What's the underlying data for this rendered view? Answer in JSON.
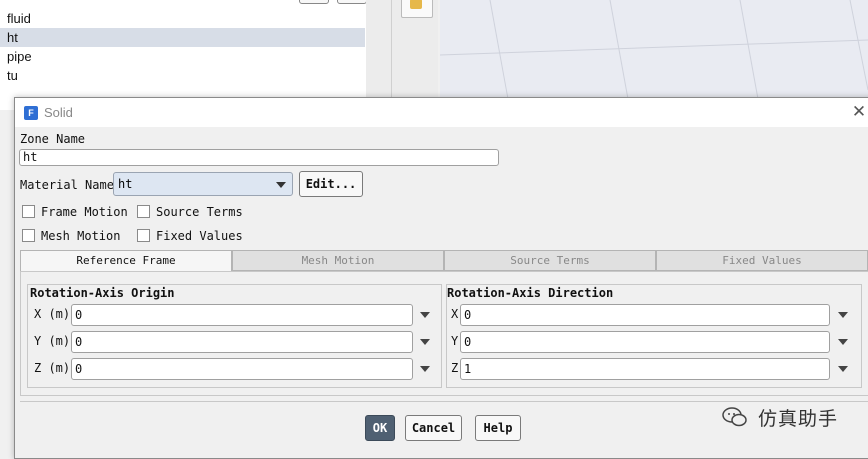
{
  "background": {
    "zone_list": [
      "fluid",
      "ht",
      "pipe",
      "tu"
    ],
    "selected_zone": "ht"
  },
  "dialog": {
    "title": "Solid",
    "app_icon": "F",
    "zone_name_label": "Zone Name",
    "zone_name_value": "ht",
    "material_label": "Material Name",
    "material_value": "ht",
    "edit_button": "Edit...",
    "checkboxes": [
      {
        "label": "Frame Motion",
        "checked": false
      },
      {
        "label": "Source Terms",
        "checked": false
      },
      {
        "label": "Mesh Motion",
        "checked": false
      },
      {
        "label": "Fixed Values",
        "checked": false
      }
    ],
    "tabs": [
      {
        "label": "Reference Frame",
        "active": true
      },
      {
        "label": "Mesh Motion",
        "active": false
      },
      {
        "label": "Source Terms",
        "active": false
      },
      {
        "label": "Fixed Values",
        "active": false
      }
    ],
    "origin": {
      "title": "Rotation-Axis Origin",
      "fields": [
        {
          "label": "X (m)",
          "value": "0"
        },
        {
          "label": "Y (m)",
          "value": "0"
        },
        {
          "label": "Z (m)",
          "value": "0"
        }
      ]
    },
    "direction": {
      "title": "Rotation-Axis Direction",
      "fields": [
        {
          "label": "X",
          "value": "0"
        },
        {
          "label": "Y",
          "value": "0"
        },
        {
          "label": "Z",
          "value": "1"
        }
      ]
    },
    "buttons": {
      "ok": "OK",
      "cancel": "Cancel",
      "help": "Help"
    }
  },
  "watermark": {
    "text": "仿真助手"
  },
  "icons": [
    "close-icon",
    "dropdown-arrow-icon",
    "wechat-icon",
    "app-icon"
  ],
  "colors": {
    "primary_button": "#4f6072",
    "selection": "#d7dde7",
    "select_bg": "#dde6f2"
  }
}
